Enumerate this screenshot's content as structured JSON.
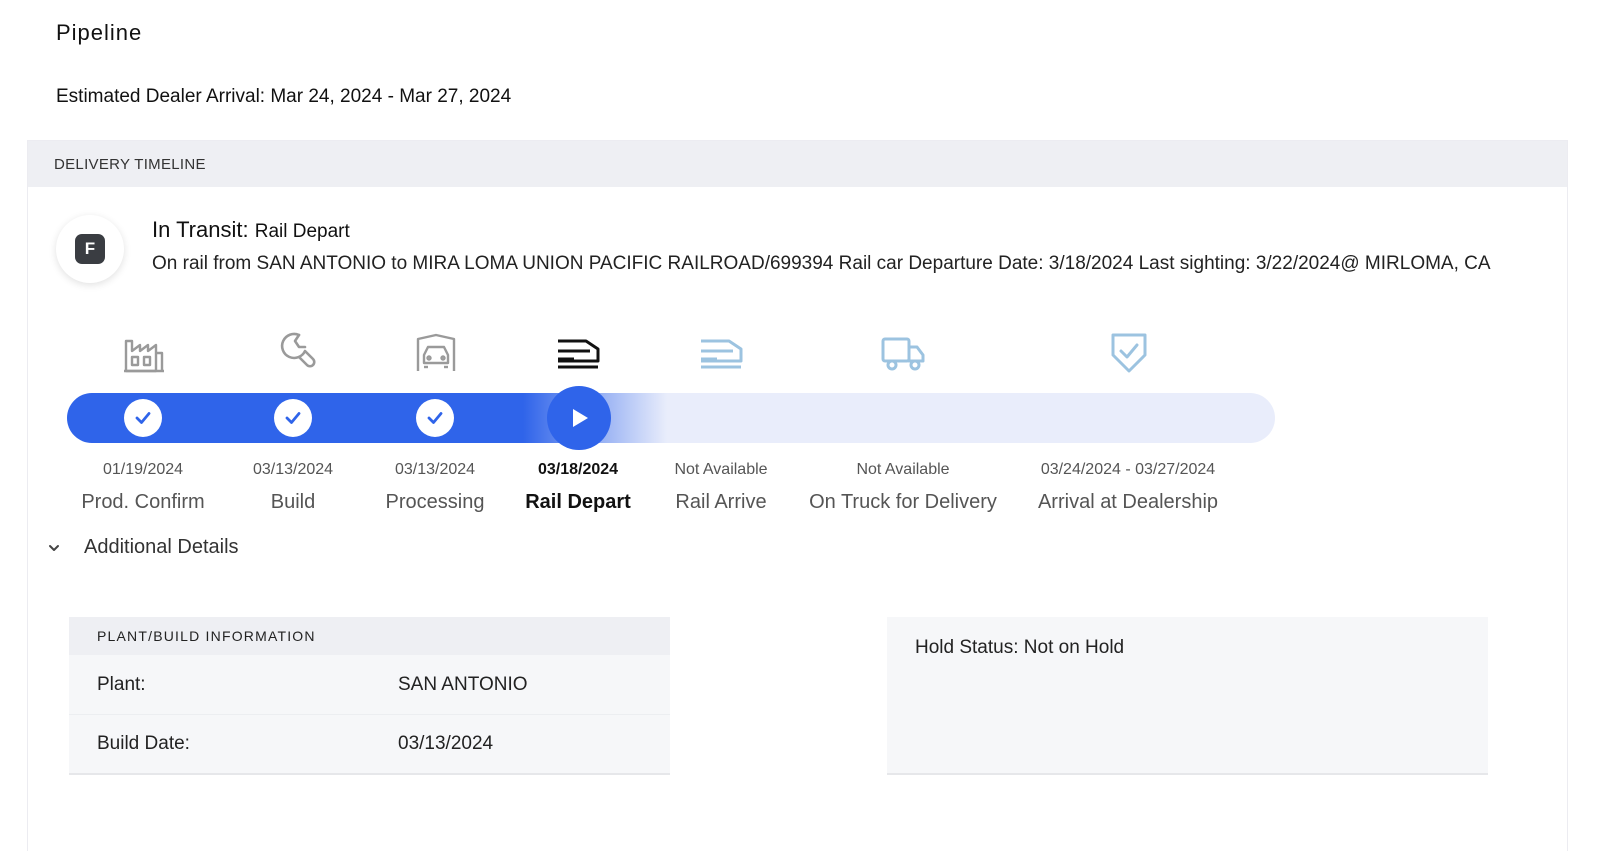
{
  "page": {
    "title": "Pipeline",
    "eta": "Estimated Dealer Arrival: Mar 24, 2024 - Mar 27, 2024"
  },
  "timeline": {
    "header": "DELIVERY TIMELINE",
    "status_badge": "F",
    "status_prefix": "In Transit:",
    "status_stage": "Rail Depart",
    "status_description": "On rail from SAN ANTONIO to MIRA LOMA UNION PACIFIC RAILROAD/699394 Rail car Departure Date: 3/18/2024 Last sighting: 3/22/2024@ MIRLOMA, CA",
    "stages": [
      {
        "icon": "factory-icon",
        "date": "01/19/2024",
        "label": "Prod. Confirm",
        "status": "complete"
      },
      {
        "icon": "wrench-icon",
        "date": "03/13/2024",
        "label": "Build",
        "status": "complete"
      },
      {
        "icon": "car-processing-icon",
        "date": "03/13/2024",
        "label": "Processing",
        "status": "complete"
      },
      {
        "icon": "train-depart-icon",
        "date": "03/18/2024",
        "label": "Rail Depart",
        "status": "current"
      },
      {
        "icon": "train-arrive-icon",
        "date": "Not Available",
        "label": "Rail Arrive",
        "status": "pending"
      },
      {
        "icon": "truck-icon",
        "date": "Not Available",
        "label": "On Truck for Delivery",
        "status": "pending"
      },
      {
        "icon": "shield-check-icon",
        "date": "03/24/2024 - 03/27/2024",
        "label": "Arrival at Dealership",
        "status": "pending"
      }
    ],
    "colors": {
      "progress": "#2f64ea",
      "track": "#e9edfb",
      "pending_icon": "#9cc3e0",
      "done_icon": "#9a9a9a"
    }
  },
  "details": {
    "toggle_label": "Additional Details",
    "plant_card": {
      "header": "PLANT/BUILD INFORMATION",
      "rows": [
        {
          "key": "Plant:",
          "value": "SAN ANTONIO"
        },
        {
          "key": "Build Date:",
          "value": "03/13/2024"
        }
      ]
    },
    "hold_status": "Hold Status: Not on Hold"
  }
}
